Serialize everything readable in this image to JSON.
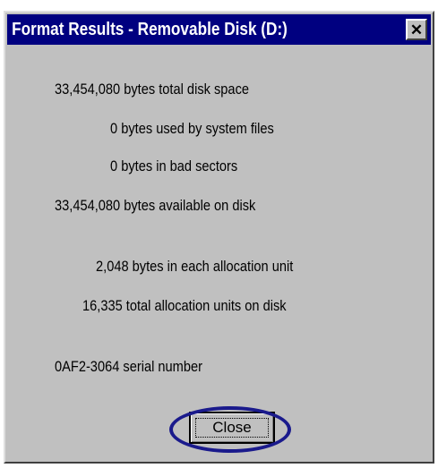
{
  "window": {
    "title": "Format Results - Removable Disk (D:)",
    "close_glyph": "✕"
  },
  "results": {
    "lines": [
      "33,454,080 bytes total disk space",
      "0 bytes used by system files",
      "0 bytes in bad sectors",
      "33,454,080 bytes available on disk",
      "2,048 bytes in each allocation unit",
      "16,335 total allocation units on disk",
      "0AF2-3064 serial number"
    ]
  },
  "buttons": {
    "close_label": "Close"
  },
  "colors": {
    "titlebar": "#000080",
    "face": "#c0c0c0",
    "highlight_ring": "#1a1a8c"
  }
}
